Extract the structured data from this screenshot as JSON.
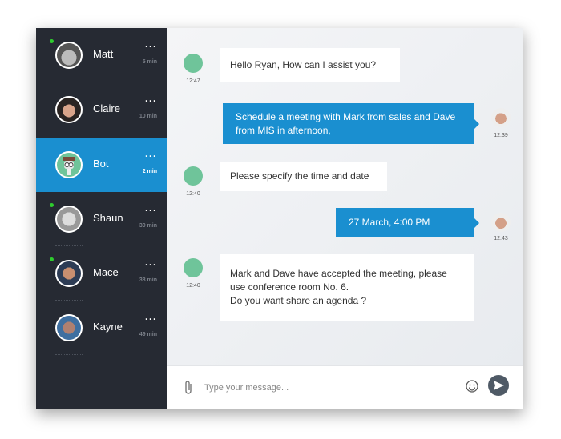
{
  "contacts": [
    {
      "name": "Matt",
      "time": "5 min",
      "more": "···",
      "online": true,
      "avatar": "matt-avatar"
    },
    {
      "name": "Claire",
      "time": "10 min",
      "more": "···",
      "online": false,
      "avatar": "claire-avatar"
    },
    {
      "name": "Bot",
      "time": "2 min",
      "more": "···",
      "online": false,
      "active": true,
      "avatar": "bot-avatar"
    },
    {
      "name": "Shaun",
      "time": "30 min",
      "more": "···",
      "online": true,
      "avatar": "shaun-avatar"
    },
    {
      "name": "Mace",
      "time": "38 min",
      "more": "···",
      "online": true,
      "avatar": "mace-avatar"
    },
    {
      "name": "Kayne",
      "time": "49 min",
      "more": "···",
      "online": false,
      "avatar": "kayne-avatar"
    }
  ],
  "messages": [
    {
      "from": "bot",
      "text": "Hello Ryan, How can I assist you?",
      "time": "12:47"
    },
    {
      "from": "me",
      "text": "Schedule a meeting with Mark from sales and Dave from MIS in afternoon,",
      "time": "12:39"
    },
    {
      "from": "bot",
      "text": "Please specify the time and date",
      "time": "12:40"
    },
    {
      "from": "me",
      "text": "27 March, 4:00 PM",
      "time": "12:43"
    },
    {
      "from": "bot",
      "text": "Mark and Dave have accepted the meeting, please use conference room No. 6.\nDo you want share an agenda ?",
      "time": "12:40"
    }
  ],
  "composer": {
    "placeholder": "Type your message...",
    "value": ""
  },
  "colors": {
    "sidebar": "#262a33",
    "accent": "#1a8fd0",
    "online": "#2ecc2e",
    "send": "#4f5a66"
  }
}
